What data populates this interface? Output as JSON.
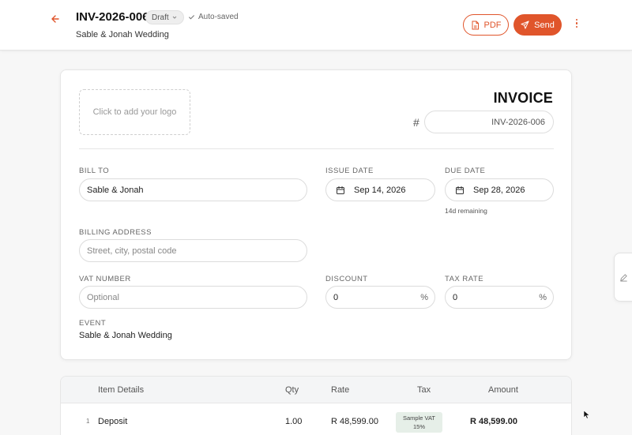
{
  "header": {
    "invoice_id": "INV-2026-006",
    "status": "Draft",
    "autosave": "Auto-saved",
    "client": "Sable & Jonah Wedding",
    "pdf_label": "PDF",
    "send_label": "Send"
  },
  "invoice": {
    "logo_placeholder": "Click to add your logo",
    "heading": "INVOICE",
    "hash": "#",
    "number": "INV-2026-006",
    "bill_to": {
      "label": "BILL TO",
      "value": "Sable & Jonah"
    },
    "issue_date": {
      "label": "ISSUE DATE",
      "value": "Sep 14, 2026"
    },
    "due_date": {
      "label": "DUE DATE",
      "value": "Sep 28, 2026",
      "hint": "14d remaining"
    },
    "billing_address": {
      "label": "BILLING ADDRESS",
      "placeholder": "Street, city, postal code"
    },
    "vat_number": {
      "label": "VAT NUMBER",
      "placeholder": "Optional"
    },
    "discount": {
      "label": "DISCOUNT",
      "value": "0",
      "unit": "%"
    },
    "tax_rate": {
      "label": "TAX RATE",
      "value": "0",
      "unit": "%"
    },
    "event": {
      "label": "EVENT",
      "value": "Sable & Jonah Wedding"
    }
  },
  "items": {
    "columns": [
      "Item Details",
      "Qty",
      "Rate",
      "Tax",
      "Amount"
    ],
    "rows": [
      {
        "num": "1",
        "details": "Deposit",
        "qty": "1.00",
        "rate": "R 48,599.00",
        "tax_name": "Sample VAT",
        "tax_pct": "15%",
        "amount": "R 48,599.00"
      }
    ]
  },
  "icons": {
    "back": "arrow-left-icon",
    "status_dropdown": "chevron-down-icon",
    "autosave": "check-icon",
    "pdf": "file-icon",
    "send": "send-icon",
    "more": "more-vertical-icon",
    "calendar": "calendar-icon",
    "edit": "pencil-icon"
  },
  "colors": {
    "accent": "#e0552b",
    "tax_badge": "#e6efe8"
  }
}
